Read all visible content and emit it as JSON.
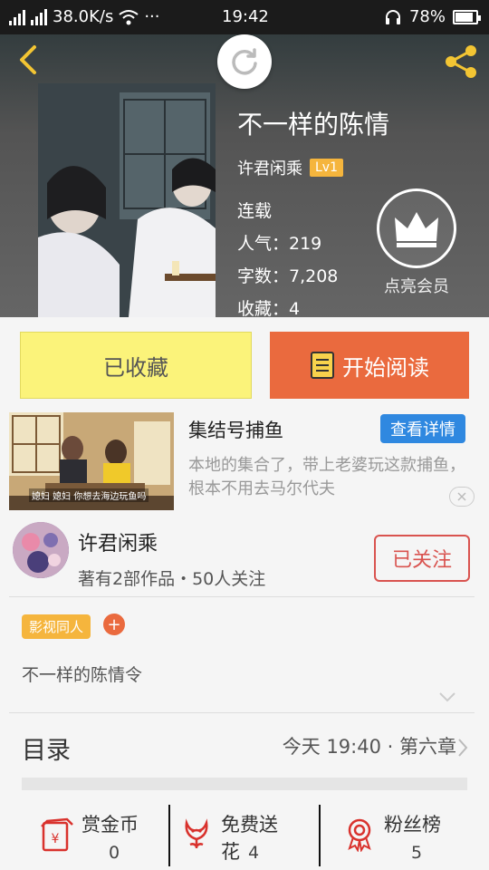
{
  "status_bar": {
    "speed": "38.0K/s",
    "more": "···",
    "time": "19:42",
    "battery": "78%",
    "battery_level": 0.78
  },
  "book": {
    "title": "不一样的陈情",
    "author": "许君闲乘",
    "level": "Lv1",
    "status": "连载",
    "popularity": "人气：219",
    "word_count": "字数：7,208",
    "favorites": "收藏：4",
    "vip_label": "点亮会员"
  },
  "actions": {
    "favorite": "已收藏",
    "read": "开始阅读"
  },
  "ad": {
    "title": "集结号捕鱼",
    "button": "查看详情",
    "description": "本地的集合了，带上老婆玩这款捕鱼，根本不用去马尔代夫",
    "image_caption": "媳妇 媳妇 你想去海边玩鱼吗"
  },
  "author_card": {
    "name": "许君闲乘",
    "meta": "著有2部作品・50人关注",
    "follow": "已关注"
  },
  "tags": {
    "tag": "影视同人",
    "add": "+"
  },
  "intro": "不一样的陈情令",
  "toc": {
    "label": "目录",
    "latest": "今天 19:40 · 第六章"
  },
  "bottom": {
    "items": [
      {
        "label": "赏金币",
        "count": "0",
        "icon": "coin-envelope-icon"
      },
      {
        "label": "免费送花",
        "count": "4",
        "icon": "flower-icon"
      },
      {
        "label": "粉丝榜",
        "count": "5",
        "icon": "medal-icon"
      }
    ]
  },
  "colors": {
    "accent_orange": "#ea6a3e",
    "favorite_yellow": "#fbf37a",
    "badge_gold": "#f5b53d",
    "ad_blue": "#2f88e0",
    "follow_red": "#d9534f",
    "back_yellow": "#f3c533"
  }
}
